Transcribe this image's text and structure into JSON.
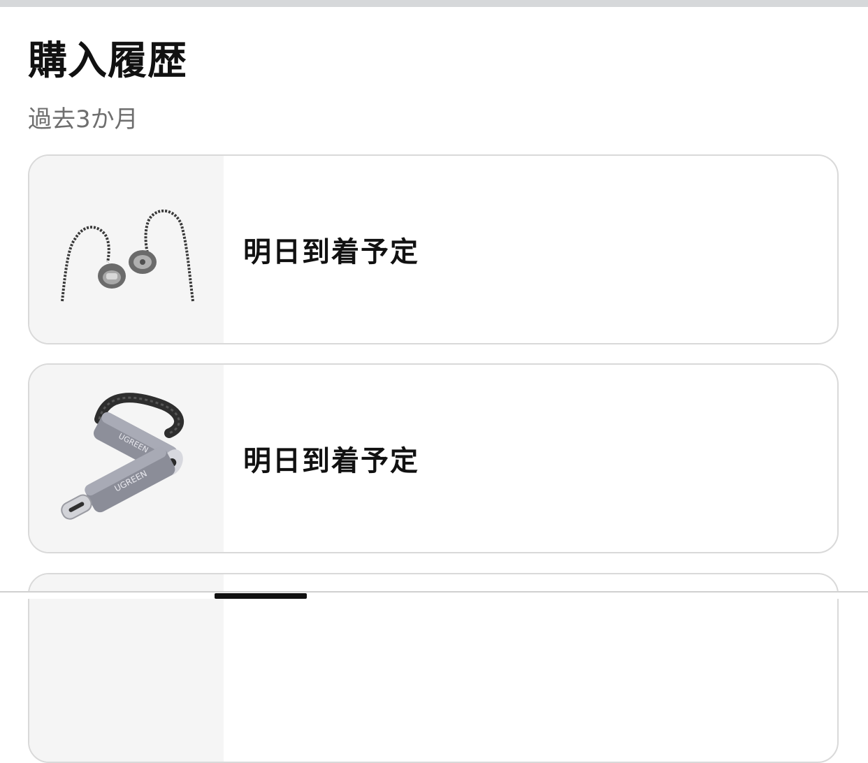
{
  "page": {
    "title": "購入履歴",
    "subtitle": "過去3か月"
  },
  "orders": [
    {
      "status": "明日到着予定",
      "product_image": "in-ear-earphones"
    },
    {
      "status": "明日到着予定",
      "product_image": "usb-c-audio-adapter",
      "image_brand_text": "UGREEN"
    },
    {
      "status": "",
      "product_image": ""
    }
  ]
}
